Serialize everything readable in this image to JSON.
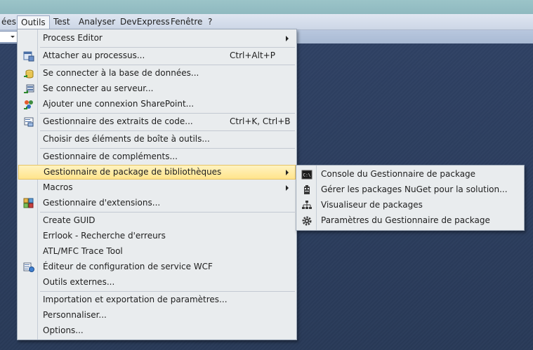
{
  "menubar": {
    "items": [
      {
        "label": "ées"
      },
      {
        "label": "Outils"
      },
      {
        "label": "Test"
      },
      {
        "label": "Analyser"
      },
      {
        "label": "DevExpress"
      },
      {
        "label": "Fenêtre"
      },
      {
        "label": "?"
      }
    ]
  },
  "outils_menu": {
    "items": [
      {
        "label": "Process Editor",
        "shortcut": "",
        "submenu": true,
        "icon": ""
      },
      {
        "label": "Attacher au processus...",
        "shortcut": "Ctrl+Alt+P",
        "icon": "attach-process-icon"
      },
      {
        "label": "Se connecter à la base de données...",
        "shortcut": "",
        "icon": "connect-database-icon"
      },
      {
        "label": "Se connecter au serveur...",
        "shortcut": "",
        "icon": "connect-server-icon"
      },
      {
        "label": "Ajouter une connexion SharePoint...",
        "shortcut": "",
        "icon": "sharepoint-icon"
      },
      {
        "label": "Gestionnaire des extraits de code...",
        "shortcut": "Ctrl+K, Ctrl+B",
        "icon": "code-snippets-icon"
      },
      {
        "label": "Choisir des éléments de boîte à outils...",
        "shortcut": "",
        "icon": ""
      },
      {
        "label": "Gestionnaire de compléments...",
        "shortcut": "",
        "icon": ""
      },
      {
        "label": "Gestionnaire de package de bibliothèques",
        "shortcut": "",
        "submenu": true,
        "icon": ""
      },
      {
        "label": "Macros",
        "shortcut": "",
        "submenu": true,
        "icon": ""
      },
      {
        "label": "Gestionnaire d'extensions...",
        "shortcut": "",
        "icon": "extension-manager-icon"
      },
      {
        "label": "Create GUID",
        "shortcut": "",
        "icon": ""
      },
      {
        "label": "Errlook - Recherche d'erreurs",
        "shortcut": "",
        "icon": ""
      },
      {
        "label": "ATL/MFC Trace Tool",
        "shortcut": "",
        "icon": ""
      },
      {
        "label": "Éditeur de configuration de service WCF",
        "shortcut": "",
        "icon": "wcf-config-icon"
      },
      {
        "label": "Outils externes...",
        "shortcut": "",
        "icon": ""
      },
      {
        "label": "Importation et exportation de paramètres...",
        "shortcut": "",
        "icon": ""
      },
      {
        "label": "Personnaliser...",
        "shortcut": "",
        "icon": ""
      },
      {
        "label": "Options...",
        "shortcut": "",
        "icon": ""
      }
    ]
  },
  "package_submenu": {
    "items": [
      {
        "label": "Console du Gestionnaire de package",
        "icon": "console-icon"
      },
      {
        "label": "Gérer les packages NuGet pour la solution...",
        "icon": "nuget-package-icon"
      },
      {
        "label": "Visualiseur de packages",
        "icon": "package-visualizer-icon"
      },
      {
        "label": "Paramètres du Gestionnaire de package",
        "icon": "gear-icon"
      }
    ]
  },
  "colors": {
    "background": "#2b3c59",
    "highlight": "#ffe48c",
    "menu": "#e9ecee"
  }
}
